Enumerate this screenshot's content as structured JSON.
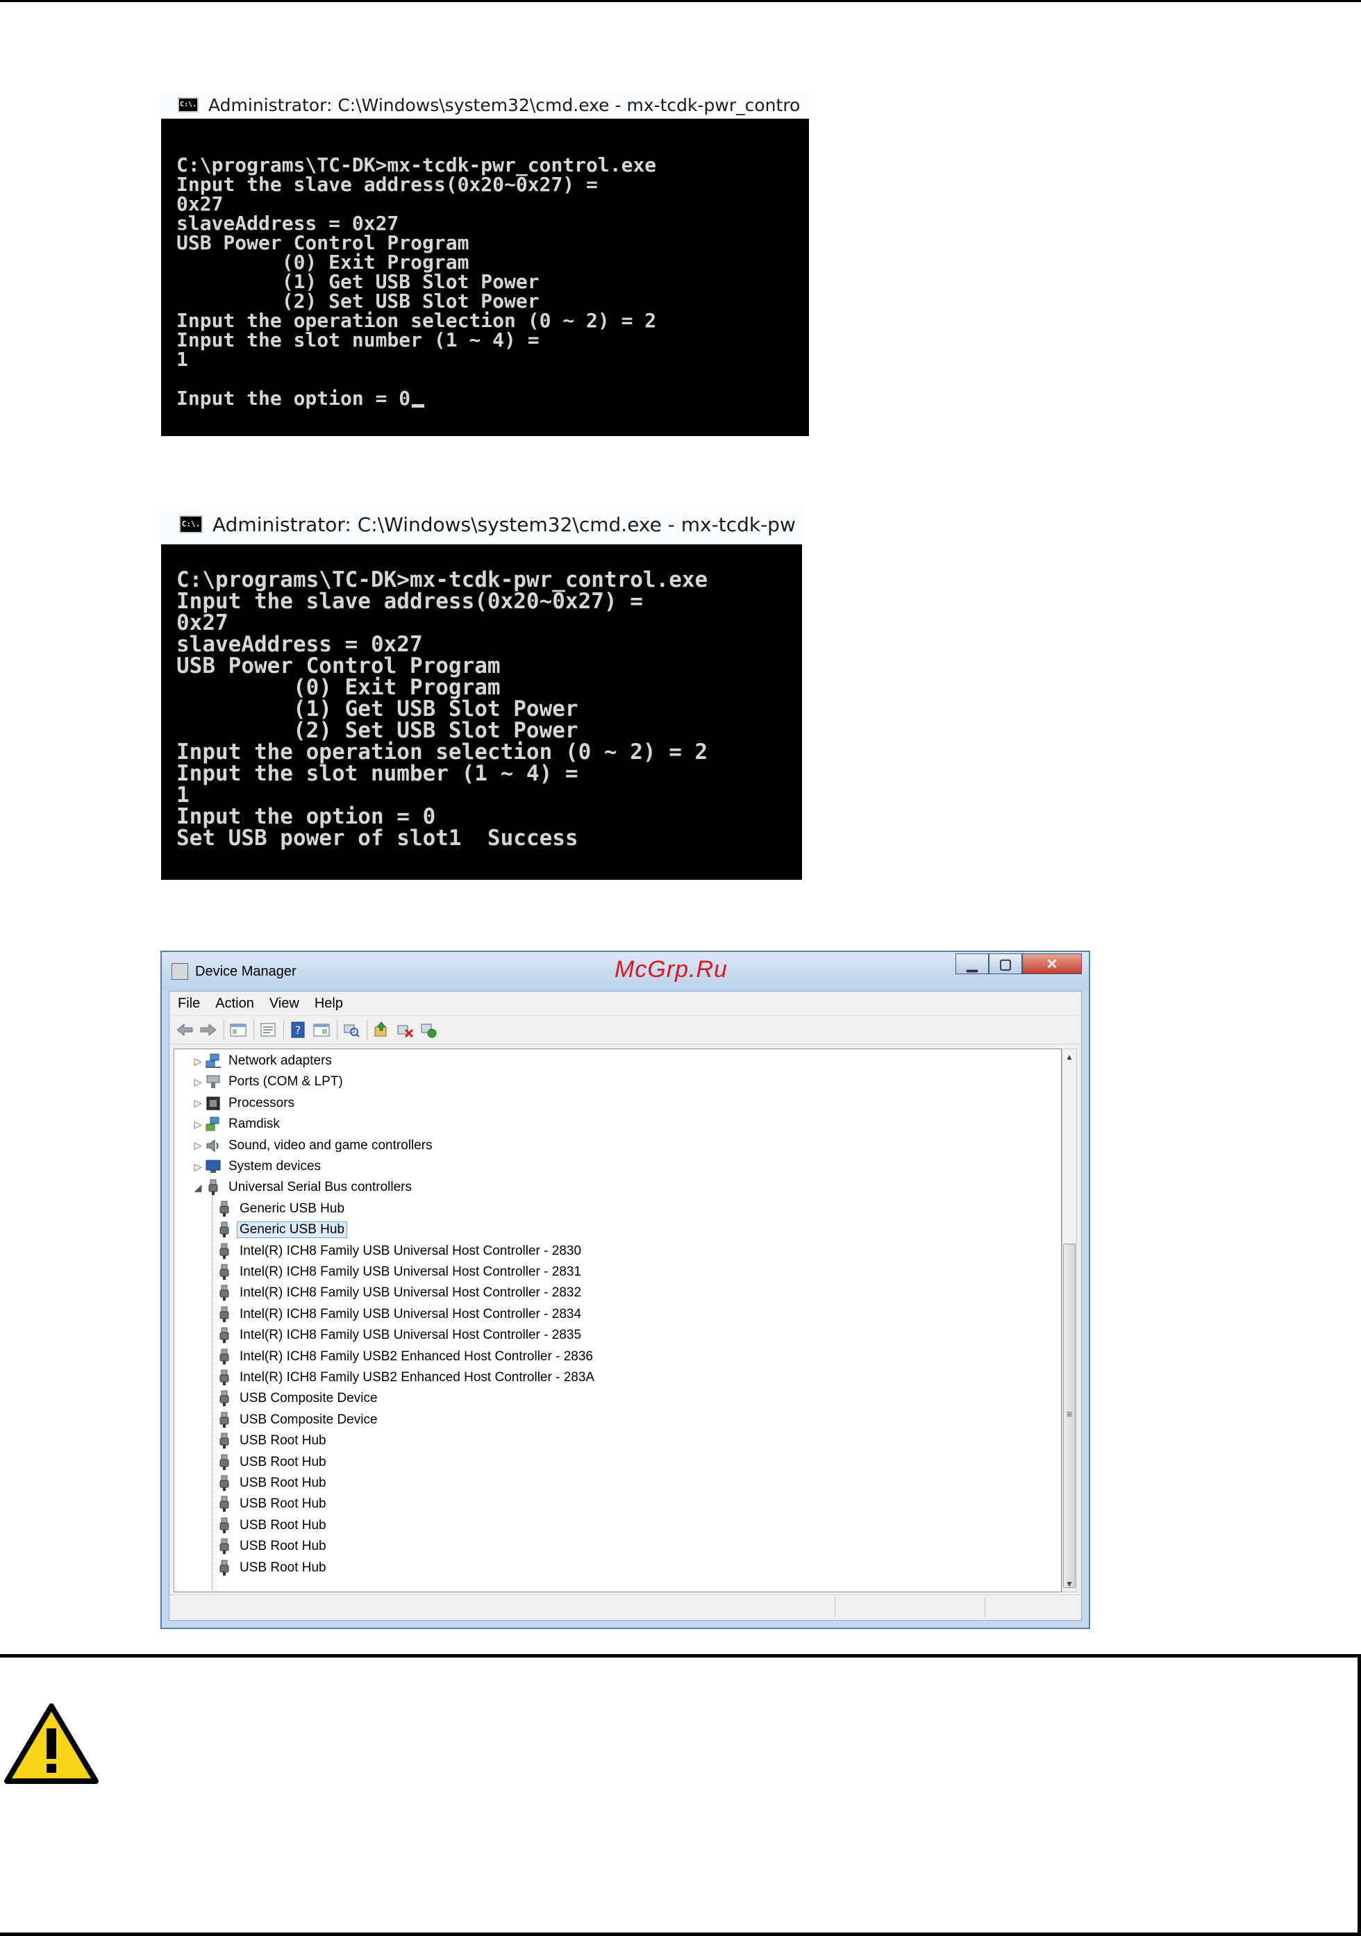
{
  "cmd_window_1": {
    "title": "Administrator: C:\\Windows\\system32\\cmd.exe - mx-tcdk-pwr_contro",
    "icon_label": "C:\\.",
    "lines": [
      "",
      "C:\\programs\\TC-DK>mx-tcdk-pwr_control.exe",
      "Input the slave address(0x20~0x27) =",
      "0x27",
      "slaveAddress = 0x27",
      "USB Power Control Program",
      "         (0) Exit Program",
      "         (1) Get USB Slot Power",
      "         (2) Set USB Slot Power",
      "Input the operation selection (0 ~ 2) = 2",
      "Input the slot number (1 ~ 4) =",
      "1",
      "",
      "Input the option = 0"
    ]
  },
  "cmd_window_2": {
    "title": "Administrator: C:\\Windows\\system32\\cmd.exe - mx-tcdk-pw",
    "icon_label": "C:\\.",
    "lines": [
      "",
      "C:\\programs\\TC-DK>mx-tcdk-pwr_control.exe",
      "Input the slave address(0x20~0x27) =",
      "0x27",
      "slaveAddress = 0x27",
      "USB Power Control Program",
      "         (0) Exit Program",
      "         (1) Get USB Slot Power",
      "         (2) Set USB Slot Power",
      "Input the operation selection (0 ~ 2) = 2",
      "Input the slot number (1 ~ 4) =",
      "1",
      "Input the option = 0",
      "Set USB power of slot1  Success"
    ]
  },
  "device_manager": {
    "title": "Device Manager",
    "watermark": "McGrp.Ru",
    "caption_buttons": {
      "minimize": "▁",
      "maximize": "▢",
      "close": "✕"
    },
    "menu": [
      "File",
      "Action",
      "View",
      "Help"
    ],
    "tree_categories": [
      {
        "label": "Network adapters",
        "expanded": false
      },
      {
        "label": "Ports (COM & LPT)",
        "expanded": false
      },
      {
        "label": "Processors",
        "expanded": false
      },
      {
        "label": "Ramdisk",
        "expanded": false
      },
      {
        "label": "Sound, video and game controllers",
        "expanded": false
      },
      {
        "label": "System devices",
        "expanded": false
      },
      {
        "label": "Universal Serial Bus controllers",
        "expanded": true
      }
    ],
    "usb_devices": [
      {
        "label": "Generic USB Hub",
        "selected": false
      },
      {
        "label": "Generic USB Hub",
        "selected": true
      },
      {
        "label": "Intel(R) ICH8 Family USB Universal Host Controller - 2830",
        "selected": false
      },
      {
        "label": "Intel(R) ICH8 Family USB Universal Host Controller - 2831",
        "selected": false
      },
      {
        "label": "Intel(R) ICH8 Family USB Universal Host Controller - 2832",
        "selected": false
      },
      {
        "label": "Intel(R) ICH8 Family USB Universal Host Controller - 2834",
        "selected": false
      },
      {
        "label": "Intel(R) ICH8 Family USB Universal Host Controller - 2835",
        "selected": false
      },
      {
        "label": "Intel(R) ICH8 Family USB2 Enhanced Host Controller - 2836",
        "selected": false
      },
      {
        "label": "Intel(R) ICH8 Family USB2 Enhanced Host Controller - 283A",
        "selected": false
      },
      {
        "label": "USB Composite Device",
        "selected": false
      },
      {
        "label": "USB Composite Device",
        "selected": false
      },
      {
        "label": "USB Root Hub",
        "selected": false
      },
      {
        "label": "USB Root Hub",
        "selected": false
      },
      {
        "label": "USB Root Hub",
        "selected": false
      },
      {
        "label": "USB Root Hub",
        "selected": false
      },
      {
        "label": "USB Root Hub",
        "selected": false
      },
      {
        "label": "USB Root Hub",
        "selected": false
      },
      {
        "label": "USB Root Hub",
        "selected": false
      }
    ]
  },
  "warning_box": {
    "icon": "warning-icon"
  },
  "colors": {
    "warning_yellow": "#f7d417",
    "watermark_red": "#e0141e",
    "selection_bg": "#dcebfc"
  }
}
